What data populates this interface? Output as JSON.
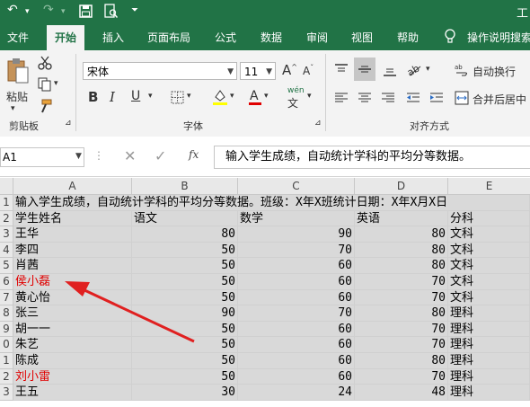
{
  "title_partial": "工",
  "tabs": [
    "文件",
    "开始",
    "插入",
    "页面布局",
    "公式",
    "数据",
    "审阅",
    "视图",
    "帮助",
    "操作说明搜索"
  ],
  "ribbon": {
    "paste_label": "粘贴",
    "clipboard_label": "剪贴板",
    "font_name": "宋体",
    "font_size": "11",
    "font_group_label": "字体",
    "wrap_label": "自动换行",
    "merge_label": "合并后居中",
    "align_group_label": "对齐方式",
    "bold": "B",
    "italic": "I",
    "underline": "U",
    "grow": "A",
    "shrink": "A",
    "wen": "wén"
  },
  "formula_bar": {
    "name_box": "A1",
    "fx": "fx",
    "content": "输入学生成绩，自动统计学科的平均分等数据。"
  },
  "sheet": {
    "columns": [
      "A",
      "B",
      "C",
      "D",
      "E"
    ],
    "rows": [
      {
        "n": "1",
        "merged": "输入学生成绩，自动统计学科的平均分等数据。班级：X年X班统计日期：X年X月X日"
      },
      {
        "n": "2",
        "a": "学生姓名",
        "b": "语文",
        "c": "数学",
        "d": "英语",
        "e": "分科",
        "red": false
      },
      {
        "n": "3",
        "a": "王华",
        "b": "80",
        "c": "90",
        "d": "80",
        "e": "文科",
        "red": false
      },
      {
        "n": "4",
        "a": "李四",
        "b": "50",
        "c": "70",
        "d": "80",
        "e": "文科",
        "red": false
      },
      {
        "n": "5",
        "a": "肖茜",
        "b": "50",
        "c": "60",
        "d": "80",
        "e": "文科",
        "red": false
      },
      {
        "n": "6",
        "a": "侯小磊",
        "b": "50",
        "c": "60",
        "d": "70",
        "e": "文科",
        "red": true
      },
      {
        "n": "7",
        "a": "黄心怡",
        "b": "50",
        "c": "60",
        "d": "70",
        "e": "文科",
        "red": false
      },
      {
        "n": "8",
        "a": "张三",
        "b": "90",
        "c": "70",
        "d": "80",
        "e": "理科",
        "red": false
      },
      {
        "n": "9",
        "a": "胡一一",
        "b": "50",
        "c": "60",
        "d": "70",
        "e": "理科",
        "red": false
      },
      {
        "n": "0",
        "a": "朱艺",
        "b": "50",
        "c": "60",
        "d": "70",
        "e": "理科",
        "red": false
      },
      {
        "n": "1",
        "a": "陈成",
        "b": "50",
        "c": "60",
        "d": "80",
        "e": "理科",
        "red": false
      },
      {
        "n": "2",
        "a": "刘小雷",
        "b": "50",
        "c": "60",
        "d": "70",
        "e": "理科",
        "red": true
      },
      {
        "n": "3",
        "a": "王五",
        "b": "30",
        "c": "24",
        "d": "48",
        "e": "理科",
        "red": false
      }
    ]
  }
}
